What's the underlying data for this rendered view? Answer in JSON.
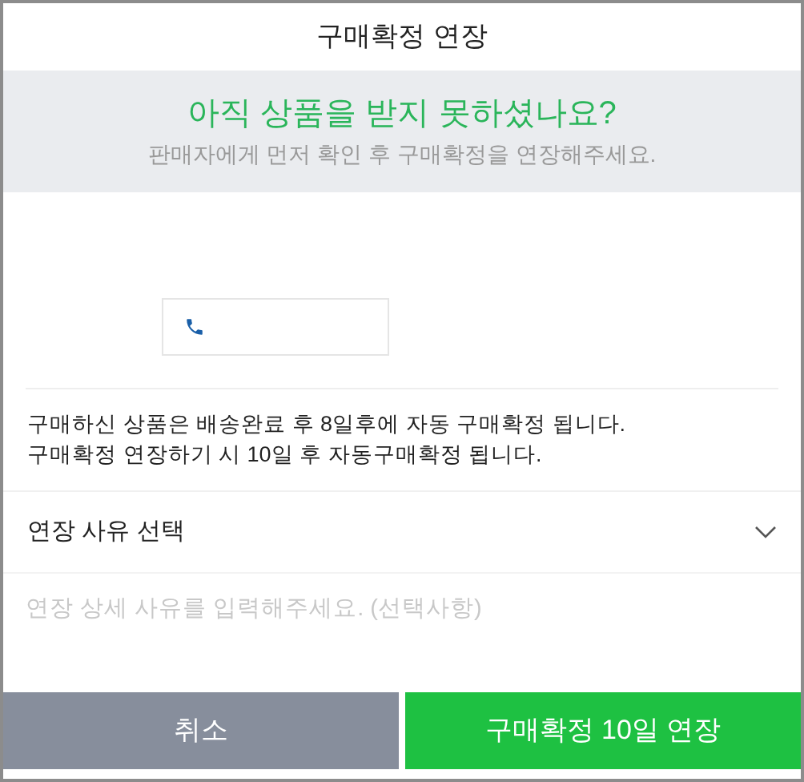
{
  "window": {
    "title": "구매확정 연장"
  },
  "banner": {
    "headline": "아직 상품을 받지 못하셨나요?",
    "subtext": "판매자에게 먼저 확인 후 구매확정을 연장해주세요."
  },
  "notice": [
    "구매하신 상품은 배송완료 후 8일후에 자동 구매확정 됩니다.",
    "구매확정 연장하기 시 10일 후 자동구매확정 됩니다."
  ],
  "reason_select": {
    "label": "연장 사유 선택"
  },
  "detail_field": {
    "placeholder": "연장 상세 사유를 입력해주세요. (선택사항)"
  },
  "buttons": [
    {
      "kind": "cancel",
      "label": "취소"
    },
    {
      "kind": "confirm",
      "label": "구매확정 10일 연장"
    }
  ]
}
